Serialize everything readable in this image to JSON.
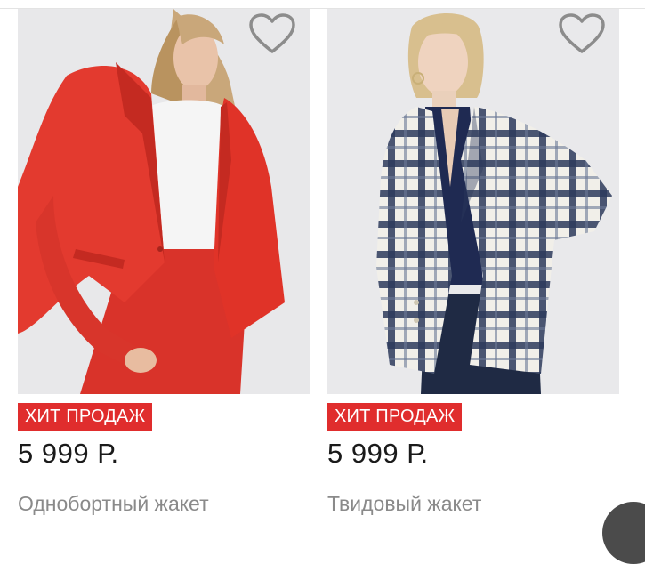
{
  "products": [
    {
      "badge": "ХИТ ПРОДАЖ",
      "price": "5 999 Р.",
      "name": "Однобортный жакет",
      "image_desc": "red-single-breasted-blazer",
      "wishlist_icon": "heart-outline-icon"
    },
    {
      "badge": "ХИТ ПРОДАЖ",
      "price": "5 999 Р.",
      "name": "Твидовый жакет",
      "image_desc": "tweed-checked-blazer",
      "wishlist_icon": "heart-outline-icon"
    }
  ],
  "colors": {
    "badge_bg": "#e02d2d",
    "price_text": "#1a1a1a",
    "name_text": "#8a8a8a",
    "photo_bg": "#e9e9ea"
  }
}
